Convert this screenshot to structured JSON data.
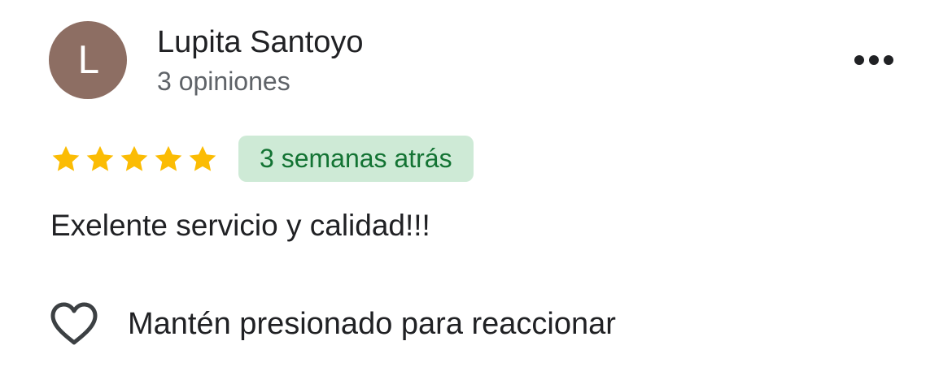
{
  "review": {
    "author": {
      "initial": "L",
      "name": "Lupita Santoyo",
      "reviews_count": "3 opiniones",
      "avatar_color": "#8d6e63"
    },
    "more_icon": "three-dots-horizontal-icon",
    "rating": 5,
    "rating_max": 5,
    "star_color": "#fbbc04",
    "date": "3 semanas atrás",
    "date_badge_bg": "#ceead6",
    "date_badge_text_color": "#137333",
    "text": "Exelente servicio y calidad!!!",
    "reaction": {
      "icon": "heart-outline-icon",
      "label": "Mantén presionado para reaccionar"
    }
  }
}
